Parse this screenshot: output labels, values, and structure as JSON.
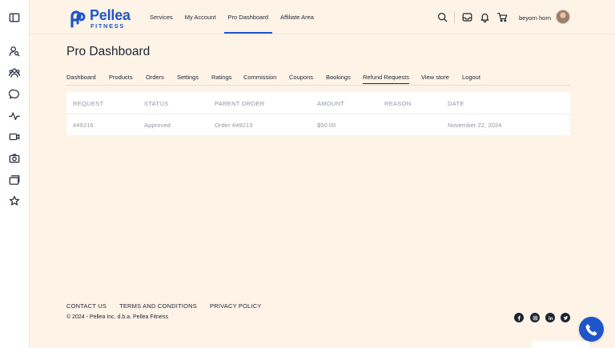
{
  "left_rail": {
    "icons": [
      "sidebar-toggle-icon",
      "user-search-icon",
      "users-icon",
      "chat-bubble-icon",
      "activity-icon",
      "video-icon",
      "camera-icon",
      "gallery-icon",
      "star-icon"
    ]
  },
  "brand": {
    "name": "Pellea",
    "subtitle": "FITNESS",
    "color": "#1f55c9"
  },
  "nav": {
    "items": [
      {
        "label": "Services"
      },
      {
        "label": "My Account"
      },
      {
        "label": "Pro Dashboard",
        "active": true
      },
      {
        "label": "Affiliate Area"
      }
    ]
  },
  "header_utils": {
    "icons": [
      "search-icon",
      "inbox-icon",
      "bell-icon",
      "cart-icon"
    ]
  },
  "user": {
    "name": "beyorn horn"
  },
  "page": {
    "title": "Pro Dashboard"
  },
  "tabs": {
    "items": [
      {
        "label": "Dashboard"
      },
      {
        "label": "Products"
      },
      {
        "label": "Orders"
      },
      {
        "label": "Settings"
      },
      {
        "label": "Ratings"
      },
      {
        "label": "Commission"
      },
      {
        "label": "Coupons"
      },
      {
        "label": "Bookings"
      },
      {
        "label": "Refund Requests",
        "active": true
      },
      {
        "label": "View store"
      },
      {
        "label": "Logout"
      }
    ]
  },
  "refund_table": {
    "columns": [
      "Request",
      "Status",
      "Parent Order",
      "Amount",
      "Reason",
      "Date"
    ],
    "rows": [
      {
        "request": "#49216",
        "status": "Approved",
        "parent_order": "Order #49213",
        "amount": "$50.00",
        "reason": "",
        "date": "November 22, 2024"
      }
    ]
  },
  "footer": {
    "links": [
      {
        "label": "CONTACT US"
      },
      {
        "label": "TERMS AND CONDITIONS"
      },
      {
        "label": "PRIVACY POLICY"
      }
    ],
    "copyright": "© 2024 - Pellea Inc. d.b.a. Pellea Fitness",
    "social_icons": [
      "facebook-icon",
      "instagram-icon",
      "linkedin-icon",
      "twitter-icon"
    ]
  },
  "colors": {
    "background": "#fdf3e6",
    "accent": "#1f55c9",
    "text": "#1d2533",
    "muted": "#8e96a3"
  }
}
